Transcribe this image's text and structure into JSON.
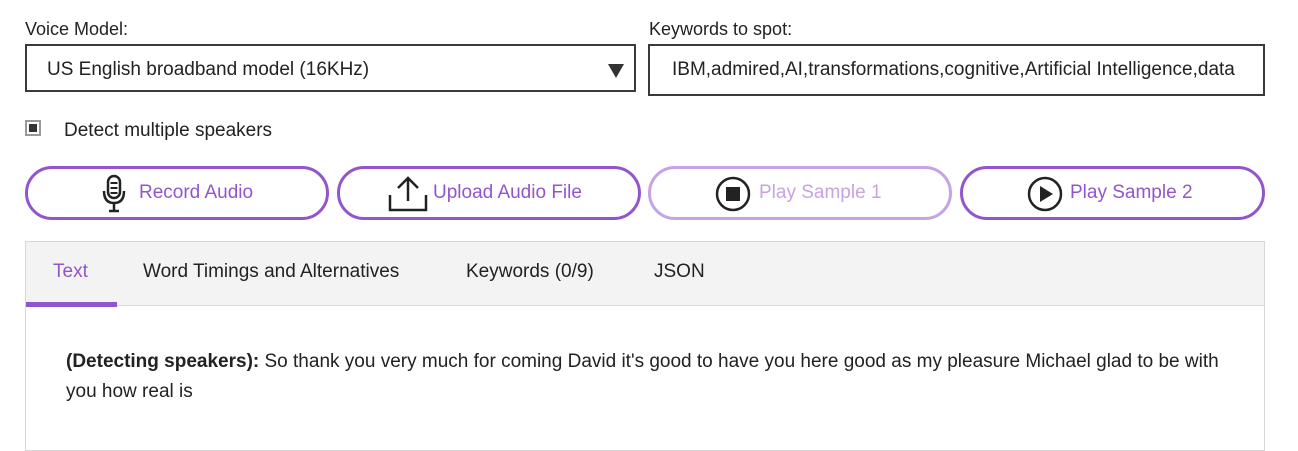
{
  "voice_model": {
    "label": "Voice Model:",
    "selected": "US English broadband model (16KHz)"
  },
  "keywords": {
    "label": "Keywords to spot:",
    "value": "IBM,admired,AI,transformations,cognitive,Artificial Intelligence,data"
  },
  "speakers": {
    "label": "Detect multiple speakers",
    "checked": true
  },
  "buttons": {
    "record": "Record Audio",
    "upload": "Upload Audio File",
    "sample1": "Play Sample 1",
    "sample2": "Play Sample 2"
  },
  "tabs": [
    {
      "label": "Text",
      "active": true
    },
    {
      "label": "Word Timings and Alternatives",
      "active": false
    },
    {
      "label": "Keywords (0/9)",
      "active": false
    },
    {
      "label": "JSON",
      "active": false
    }
  ],
  "transcript": {
    "prefix": "(Detecting speakers):",
    "text": " So thank you very much for coming David it's good to have you here good as my pleasure Michael glad to be with you how real is"
  },
  "colors": {
    "accent": "#9355cc",
    "accent_disabled": "#c5a3e6"
  }
}
